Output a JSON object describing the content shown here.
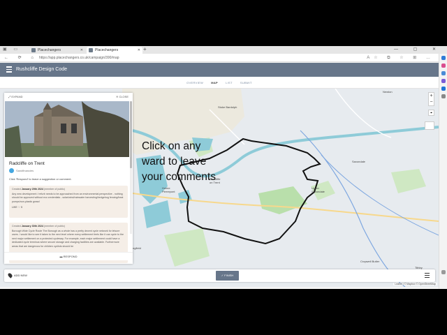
{
  "browser": {
    "tabs": [
      {
        "label": "Placechangers"
      },
      {
        "label": "Placechangers"
      }
    ],
    "url": "https://app.placechangers.co.uk/campaign/390/map"
  },
  "app": {
    "title": "Rushcliffe Design Code",
    "nav_tabs": [
      "OVERVIEW",
      "MAP",
      "LIST",
      "SUBMIT"
    ],
    "active_tab": "MAP"
  },
  "map": {
    "callout_lines": [
      "Click on any",
      "ward to leave",
      "your comments"
    ],
    "place_labels": {
      "stoke_bardolph": "Stoke Bardolph",
      "radcliffe": "Radcliffe\non Trent",
      "holme_pierrepont": "Holme\nPierrepont",
      "saxondale": "Saxondale",
      "upper_saxondale": "Upper\nSaxondale",
      "newton": "Newton",
      "cropwell_butler": "Cropwell Butler",
      "tithby": "Tithby",
      "gamston": "ngfield"
    },
    "zoom_in": "+",
    "zoom_out": "−",
    "attribution": "Leaflet | © Mapbox © OpenStreetMap",
    "colors": {
      "water": "#8ecbd8",
      "park": "#cfe8c3",
      "boundary": "#111111",
      "road": "#f7d88c"
    }
  },
  "panel": {
    "expand_label": "EXPAND",
    "close_label": "CLOSE",
    "ward_name": "Radcliffe on Trent",
    "author": "Sandfinancies",
    "prompt": "Click 'Respond' to leave a suggestion or comment.",
    "comments": [
      {
        "created": "Created",
        "date": "January 29th 2024",
        "role": "(member of public)",
        "text": "Any new development / refurb needs to be approached from an environmental perspective - nothing should be approved without eco credentials - solar/wind/rainwater harvesting/hedgehog fencing/heat pumps/non-plastic grass!",
        "likes": "LIKE",
        "like_count": "5"
      },
      {
        "created": "Created",
        "date": "January 30th 2024",
        "role": "(member of public)",
        "text": "Borough Wide Cycle Route The Borough as a whole has a pretty decent cycle network for leisure users. I would like to see it taken to the next level where every settlement feels like it can cycle to the next major settlement on a protected cycleway. For example, each major settlement could have a dedicated cycle terminus where secure storage and charging facilities are available. Furthermore areas that are dangerous for children cyclists should be"
      }
    ],
    "respond_label": "RESPOND"
  },
  "bottombar": {
    "add_new": "ADD NEW",
    "finish": "FINISH"
  }
}
